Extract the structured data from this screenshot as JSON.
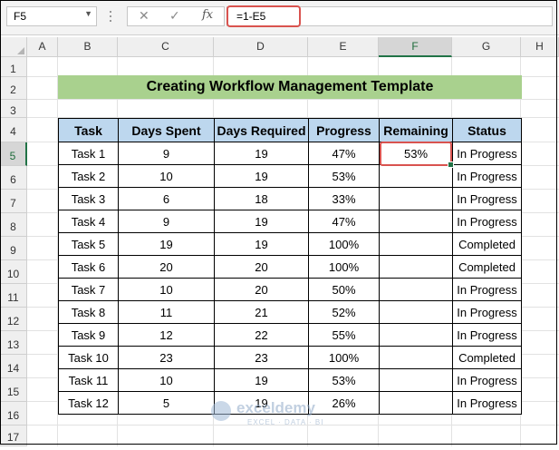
{
  "name_box": {
    "value": "F5"
  },
  "formula_bar": {
    "cancel_glyph": "✕",
    "enter_glyph": "✓",
    "fx_label": "fx",
    "formula": "=1-E5"
  },
  "columns": [
    "A",
    "B",
    "C",
    "D",
    "E",
    "F",
    "G",
    "H"
  ],
  "rows": [
    "1",
    "2",
    "3",
    "4",
    "5",
    "6",
    "7",
    "8",
    "9",
    "10",
    "11",
    "12",
    "13",
    "14",
    "15",
    "16",
    "17"
  ],
  "selected_cell": "F5",
  "sheet": {
    "title": "Creating Workflow Management Template",
    "headers": [
      "Task",
      "Days Spent",
      "Days Required",
      "Progress",
      "Remaining",
      "Status"
    ],
    "data": [
      [
        "Task 1",
        "9",
        "19",
        "47%",
        "53%",
        "In Progress"
      ],
      [
        "Task 2",
        "10",
        "19",
        "53%",
        "",
        "In Progress"
      ],
      [
        "Task 3",
        "6",
        "18",
        "33%",
        "",
        "In Progress"
      ],
      [
        "Task 4",
        "9",
        "19",
        "47%",
        "",
        "In Progress"
      ],
      [
        "Task 5",
        "19",
        "19",
        "100%",
        "",
        "Completed"
      ],
      [
        "Task 6",
        "20",
        "20",
        "100%",
        "",
        "Completed"
      ],
      [
        "Task 7",
        "10",
        "20",
        "50%",
        "",
        "In Progress"
      ],
      [
        "Task 8",
        "11",
        "21",
        "52%",
        "",
        "In Progress"
      ],
      [
        "Task 9",
        "12",
        "22",
        "55%",
        "",
        "In Progress"
      ],
      [
        "Task 10",
        "23",
        "23",
        "100%",
        "",
        "Completed"
      ],
      [
        "Task 11",
        "10",
        "19",
        "53%",
        "",
        "In Progress"
      ],
      [
        "Task 12",
        "5",
        "19",
        "26%",
        "",
        "In Progress"
      ]
    ]
  },
  "watermark": {
    "name": "exceldemy",
    "tagline": "EXCEL · DATA · BI"
  },
  "colors": {
    "title_fill": "#a9d18e",
    "header_fill": "#bdd7ee",
    "highlight": "#d9534f",
    "excel_green": "#217346"
  }
}
